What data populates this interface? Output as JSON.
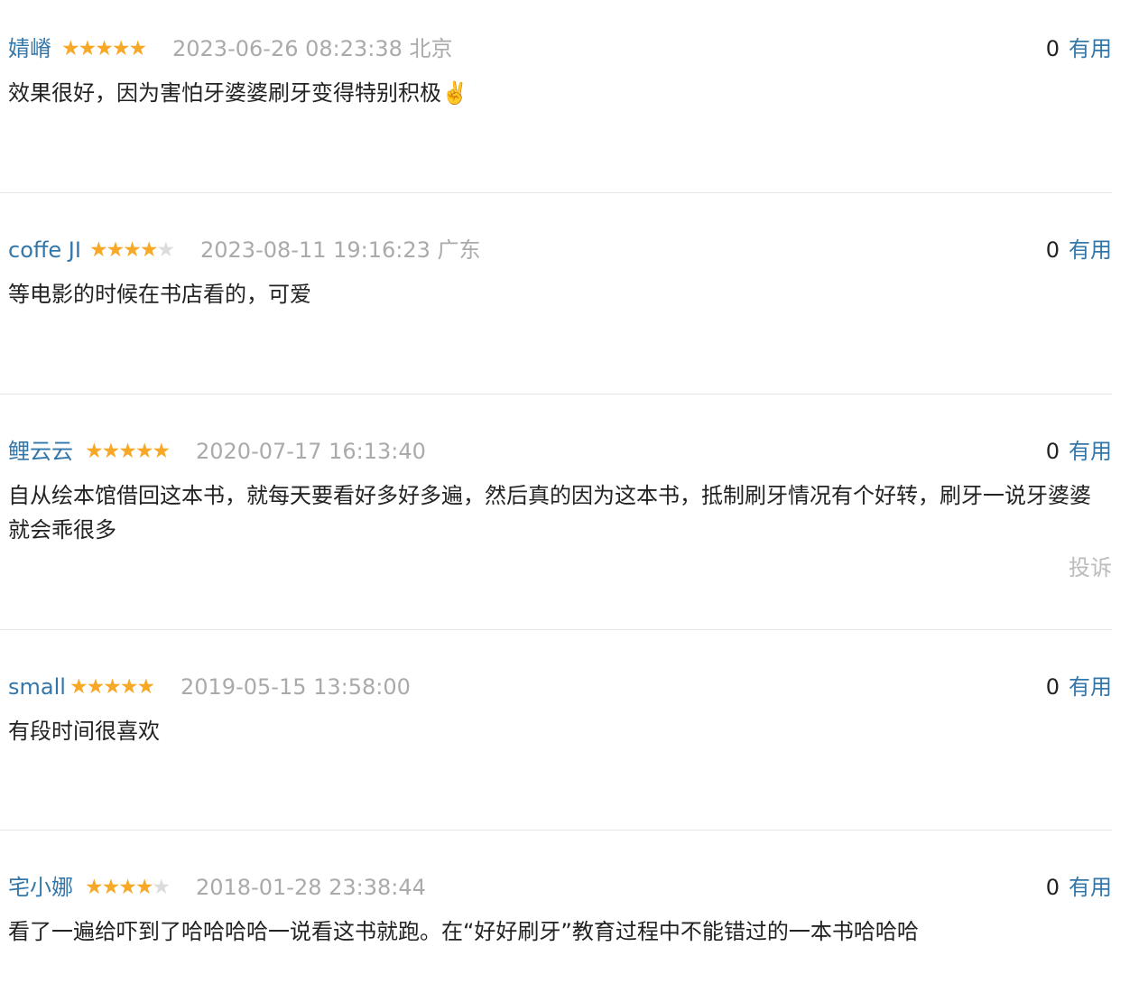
{
  "reviews": [
    {
      "author": "婧嵴",
      "rating": 5,
      "time": "2023-06-26 08:23:38",
      "location": "北京",
      "useful_count": "0",
      "useful_label": "有用",
      "content": "效果很好，因为害怕牙婆婆刷牙变得特别积极✌️"
    },
    {
      "author": "coffe JI",
      "rating": 4,
      "time": "2023-08-11 19:16:23",
      "location": "广东",
      "useful_count": "0",
      "useful_label": "有用",
      "content": "等电影的时候在书店看的，可爱"
    },
    {
      "author": "鲤云云",
      "rating": 5,
      "time": "2020-07-17 16:13:40",
      "location": "",
      "useful_count": "0",
      "useful_label": "有用",
      "content": "自从绘本馆借回这本书，就每天要看好多好多遍，然后真的因为这本书，抵制刷牙情况有个好转，刷牙一说牙婆婆就会乖很多",
      "report_label": "投诉"
    },
    {
      "author": "small",
      "rating": 5,
      "time": "2019-05-15 13:58:00",
      "location": "",
      "useful_count": "0",
      "useful_label": "有用",
      "content": "有段时间很喜欢"
    },
    {
      "author": "宅小娜",
      "rating": 4,
      "time": "2018-01-28 23:38:44",
      "location": "",
      "useful_count": "0",
      "useful_label": "有用",
      "content": "看了一遍给吓到了哈哈哈哈一说看这书就跑。在“好好刷牙”教育过程中不能错过的一本书哈哈哈"
    }
  ],
  "star_color_on": "#f7a827",
  "star_color_off": "#dcdcdc",
  "link_color": "#3377aa"
}
